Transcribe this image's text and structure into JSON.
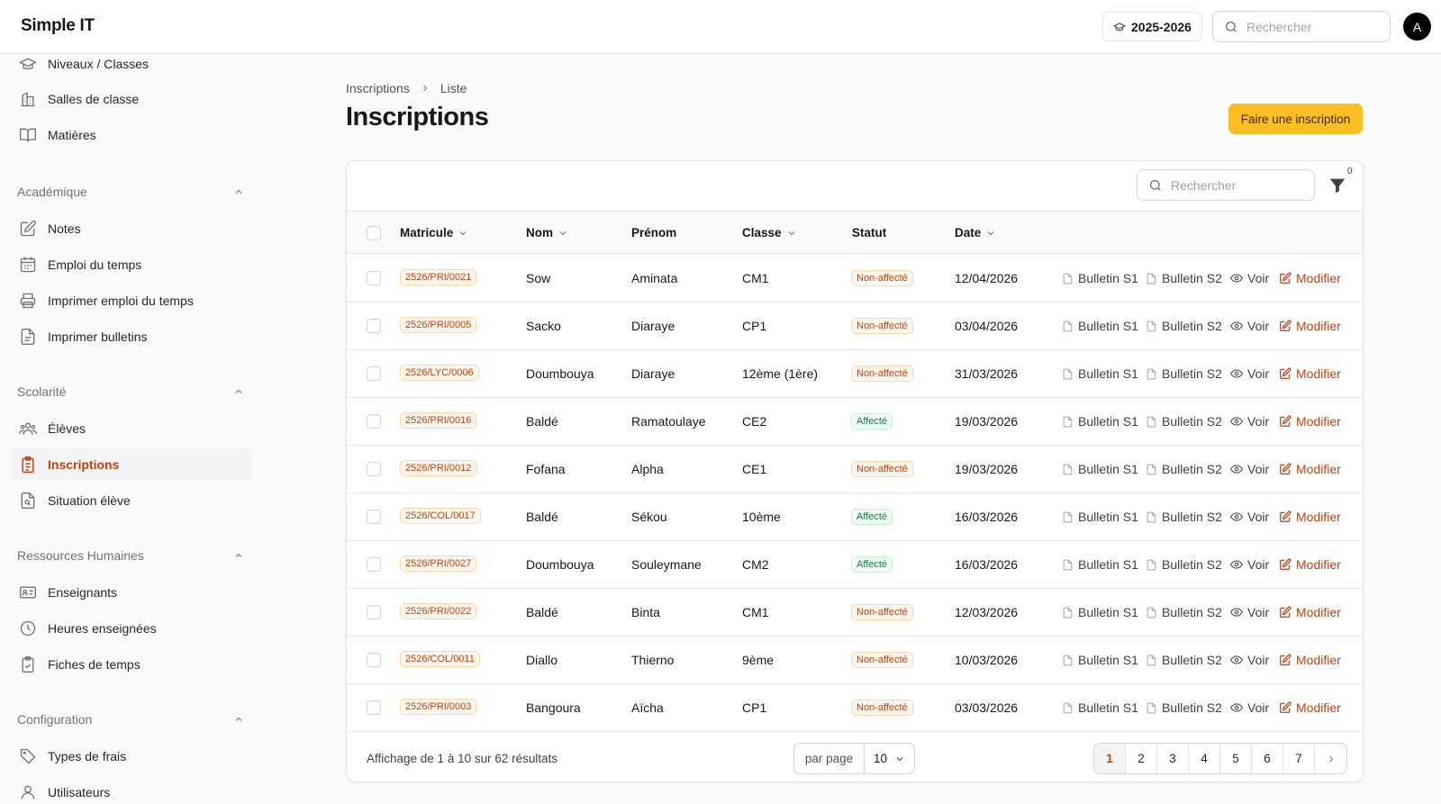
{
  "app": {
    "title": "Simple IT"
  },
  "topbar": {
    "year": "2025-2026",
    "search_placeholder": "Rechercher",
    "avatar": "A"
  },
  "sidebar": {
    "top_items": [
      {
        "label": "Niveaux / Classes",
        "icon": "graduation-cap-icon"
      },
      {
        "label": "Salles de classe",
        "icon": "building-icon"
      },
      {
        "label": "Matières",
        "icon": "book-open-icon"
      }
    ],
    "sections": [
      {
        "title": "Académique",
        "items": [
          {
            "label": "Notes",
            "icon": "pencil-square-icon"
          },
          {
            "label": "Emploi du temps",
            "icon": "calendar-icon"
          },
          {
            "label": "Imprimer emploi du temps",
            "icon": "printer-icon"
          },
          {
            "label": "Imprimer bulletins",
            "icon": "file-text-icon"
          }
        ]
      },
      {
        "title": "Scolarité",
        "items": [
          {
            "label": "Élèves",
            "icon": "users-icon"
          },
          {
            "label": "Inscriptions",
            "icon": "clipboard-list-icon",
            "active": true
          },
          {
            "label": "Situation élève",
            "icon": "file-search-icon"
          }
        ]
      },
      {
        "title": "Ressources Humaines",
        "items": [
          {
            "label": "Enseignants",
            "icon": "id-card-icon"
          },
          {
            "label": "Heures enseignées",
            "icon": "clock-icon"
          },
          {
            "label": "Fiches de temps",
            "icon": "clipboard-check-icon"
          }
        ]
      },
      {
        "title": "Configuration",
        "items": [
          {
            "label": "Types de frais",
            "icon": "tag-icon"
          },
          {
            "label": "Utilisateurs",
            "icon": "user-icon"
          }
        ]
      }
    ]
  },
  "breadcrumb": {
    "parent": "Inscriptions",
    "current": "Liste"
  },
  "page": {
    "title": "Inscriptions",
    "primary_action": "Faire une inscription"
  },
  "table": {
    "search_placeholder": "Rechercher",
    "filter_count": "0",
    "columns": [
      {
        "label": "Matricule",
        "sortable": true
      },
      {
        "label": "Nom",
        "sortable": true
      },
      {
        "label": "Prénom",
        "sortable": false
      },
      {
        "label": "Classe",
        "sortable": true
      },
      {
        "label": "Statut",
        "sortable": false
      },
      {
        "label": "Date",
        "sortable": true
      }
    ],
    "actions": {
      "bulletin1": "Bulletin S1",
      "bulletin2": "Bulletin S2",
      "view": "Voir",
      "edit": "Modifier"
    },
    "rows": [
      {
        "matricule": "2526/PRI/0021",
        "nom": "Sow",
        "prenom": "Aminata",
        "classe": "CM1",
        "statut": "Non-affecté",
        "date": "12/04/2026"
      },
      {
        "matricule": "2526/PRI/0005",
        "nom": "Sacko",
        "prenom": "Diaraye",
        "classe": "CP1",
        "statut": "Non-affecté",
        "date": "03/04/2026"
      },
      {
        "matricule": "2526/LYC/0006",
        "nom": "Doumbouya",
        "prenom": "Diaraye",
        "classe": "12ème (1ère)",
        "statut": "Non-affecté",
        "date": "31/03/2026"
      },
      {
        "matricule": "2526/PRI/0016",
        "nom": "Baldé",
        "prenom": "Ramatoulaye",
        "classe": "CE2",
        "statut": "Affecté",
        "date": "19/03/2026"
      },
      {
        "matricule": "2526/PRI/0012",
        "nom": "Fofana",
        "prenom": "Alpha",
        "classe": "CE1",
        "statut": "Non-affecté",
        "date": "19/03/2026"
      },
      {
        "matricule": "2526/COL/0017",
        "nom": "Baldé",
        "prenom": "Sékou",
        "classe": "10ème",
        "statut": "Affecté",
        "date": "16/03/2026"
      },
      {
        "matricule": "2526/PRI/0027",
        "nom": "Doumbouya",
        "prenom": "Souleymane",
        "classe": "CM2",
        "statut": "Affecté",
        "date": "16/03/2026"
      },
      {
        "matricule": "2526/PRI/0022",
        "nom": "Baldé",
        "prenom": "Binta",
        "classe": "CM1",
        "statut": "Non-affecté",
        "date": "12/03/2026"
      },
      {
        "matricule": "2526/COL/0011",
        "nom": "Diallo",
        "prenom": "Thierno",
        "classe": "9ème",
        "statut": "Non-affecté",
        "date": "10/03/2026"
      },
      {
        "matricule": "2526/PRI/0003",
        "nom": "Bangoura",
        "prenom": "Aïcha",
        "classe": "CP1",
        "statut": "Non-affecté",
        "date": "03/03/2026"
      }
    ]
  },
  "pagination": {
    "summary": "Affichage de 1 à 10 sur 62 résultats",
    "per_page_label": "par page",
    "per_page_value": "10",
    "pages": [
      "1",
      "2",
      "3",
      "4",
      "5",
      "6",
      "7"
    ],
    "current_page": "1"
  },
  "colors": {
    "accent": "#c2410c",
    "primary_button": "#fbbf24",
    "success": "#15803d"
  }
}
